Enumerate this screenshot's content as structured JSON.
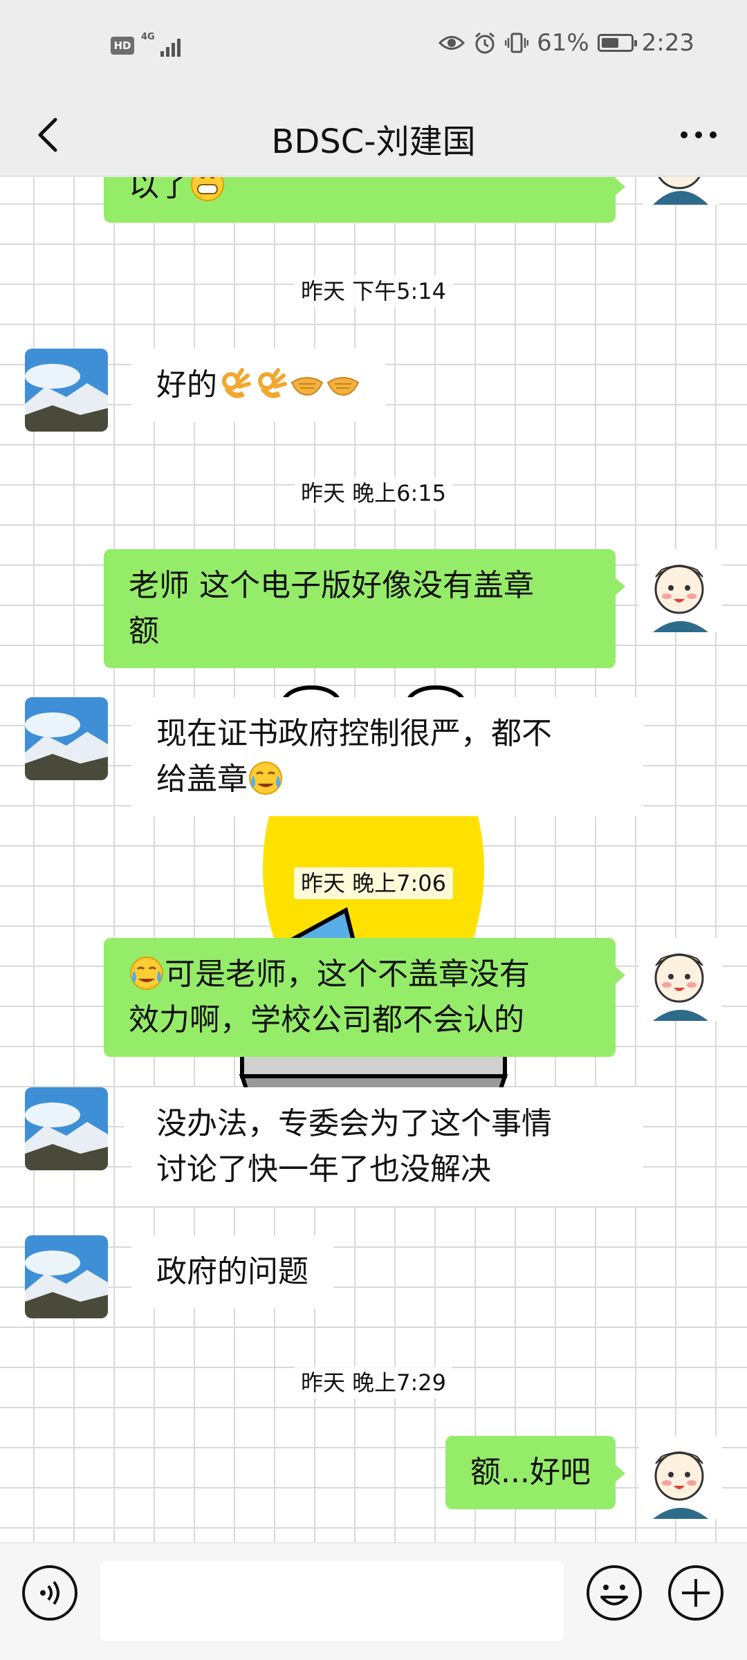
{
  "status_bar": {
    "hd": "HD",
    "network": "4G",
    "battery_text": "61%",
    "battery_level": 0.61,
    "time": "2:23"
  },
  "header": {
    "title": "BDSC-刘建国",
    "back_icon": "chevron-left-icon",
    "more_icon": "more-icon"
  },
  "messages": [
    {
      "type": "out",
      "text": "以了",
      "emoji": "grin"
    },
    {
      "type": "time",
      "text": "昨天 下午5:14"
    },
    {
      "type": "in",
      "text": "好的",
      "emoji": [
        "ok-hand",
        "ok-hand",
        "handshake",
        "handshake"
      ]
    },
    {
      "type": "time",
      "text": "昨天 晚上6:15"
    },
    {
      "type": "out",
      "lines": [
        "老师 这个电子版好像没有盖章",
        "额"
      ]
    },
    {
      "type": "in",
      "lines": [
        "现在证书政府控制很严，都不",
        "给盖章"
      ],
      "emoji": "tears-of-joy"
    },
    {
      "type": "time",
      "text": "昨天 晚上7:06"
    },
    {
      "type": "out",
      "lines": [
        "可是老师，这个不盖章没有",
        "效力啊，学校公司都不会认的"
      ],
      "emoji_prefix": "tears-of-joy"
    },
    {
      "type": "in",
      "lines": [
        "没办法，专委会为了这个事情",
        "讨论了快一年了也没解决"
      ]
    },
    {
      "type": "in",
      "text": "政府的问题"
    },
    {
      "type": "time",
      "text": "昨天 晚上7:29"
    },
    {
      "type": "out",
      "text": "额...好吧"
    }
  ],
  "input_bar": {
    "voice_icon": "voice-icon",
    "emoji_icon": "emoji-icon",
    "add_icon": "plus-icon",
    "input_value": ""
  },
  "colors": {
    "outgoing_bubble": "#95ec69",
    "incoming_bubble": "#ffffff",
    "background": "#ededed"
  }
}
